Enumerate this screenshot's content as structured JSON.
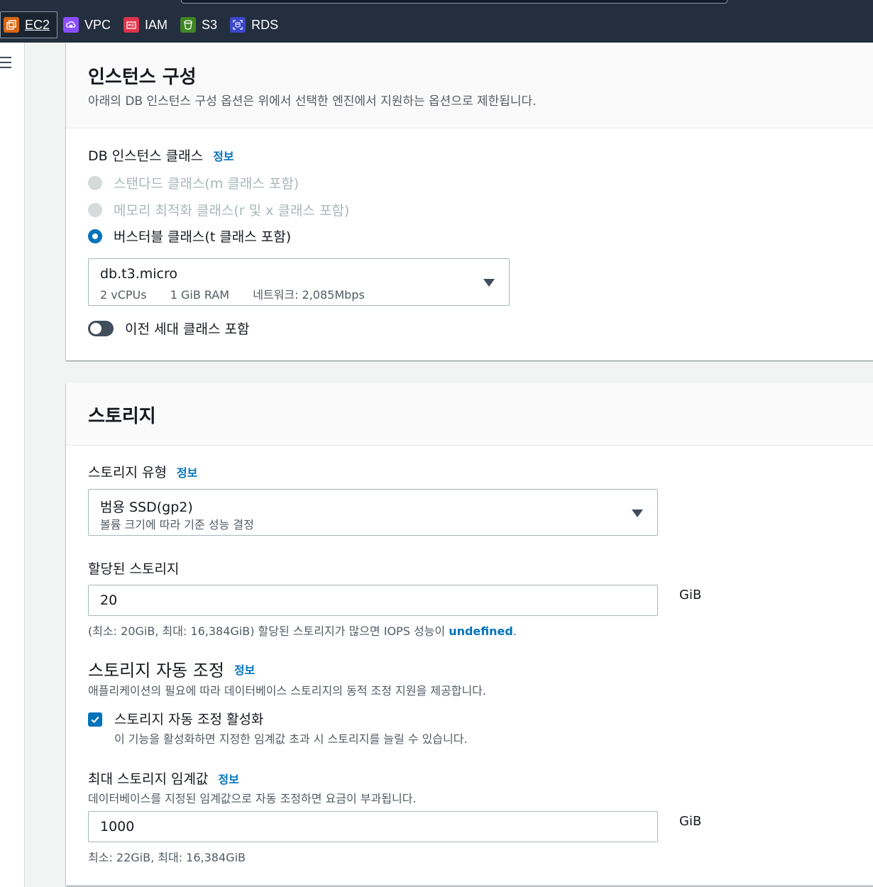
{
  "favorites": [
    {
      "label": "EC2",
      "icon": "ec2-icon",
      "color": "#d86613",
      "active": true
    },
    {
      "label": "VPC",
      "icon": "vpc-icon",
      "color": "#8c4fff"
    },
    {
      "label": "IAM",
      "icon": "iam-icon",
      "color": "#dd344c"
    },
    {
      "label": "S3",
      "icon": "s3-icon",
      "color": "#3f8624"
    },
    {
      "label": "RDS",
      "icon": "rds-icon",
      "color": "#3b48cc"
    }
  ],
  "instance_config": {
    "title": "인스턴스 구성",
    "description": "아래의 DB 인스턴스 구성 옵션은 위에서 선택한 엔진에서 지원하는 옵션으로 제한됩니다.",
    "class_label": "DB 인스턴스 클래스",
    "info": "정보",
    "options": [
      {
        "label": "스탠다드 클래스(m 클래스 포함)",
        "state": "disabled"
      },
      {
        "label": "메모리 최적화 클래스(r 및 x 클래스 포함)",
        "state": "disabled"
      },
      {
        "label": "버스터블 클래스(t 클래스 포함)",
        "state": "checked"
      }
    ],
    "selected_class": "db.t3.micro",
    "class_vcpu": "2 vCPUs",
    "class_ram": "1 GiB RAM",
    "class_network": "네트워크: 2,085Mbps",
    "prev_gen_toggle": "이전 세대 클래스 포함"
  },
  "storage": {
    "title": "스토리지",
    "type_label": "스토리지 유형",
    "info": "정보",
    "type_value": "범용 SSD(gp2)",
    "type_desc": "볼륨 크기에 따라 기준 성능 결정",
    "allocated_label": "할당된 스토리지",
    "allocated_value": "20",
    "unit": "GiB",
    "allocated_hint": "(최소: 20GiB, 최대: 16,384GiB) 할당된 스토리지가 많으면 IOPS 성능이 ",
    "allocated_hint_link": "undefined",
    "allocated_hint_end": ".",
    "autoscaling_title": "스토리지 자동 조정",
    "autoscaling_desc": "애플리케이션의 필요에 따라 데이터베이스 스토리지의 동적 조정 지원을 제공합니다.",
    "autoscaling_checkbox": "스토리지 자동 조정 활성화",
    "autoscaling_checkbox_desc": "이 기능을 활성화하면 지정한 임계값 초과 시 스토리지를 늘릴 수 있습니다.",
    "max_label": "최대 스토리지 임계값",
    "max_desc": "데이터베이스를 지정된 임계값으로 자동 조정하면 요금이 부과됩니다.",
    "max_value": "1000",
    "max_hint": "최소: 22GiB, 최대: 16,384GiB"
  }
}
